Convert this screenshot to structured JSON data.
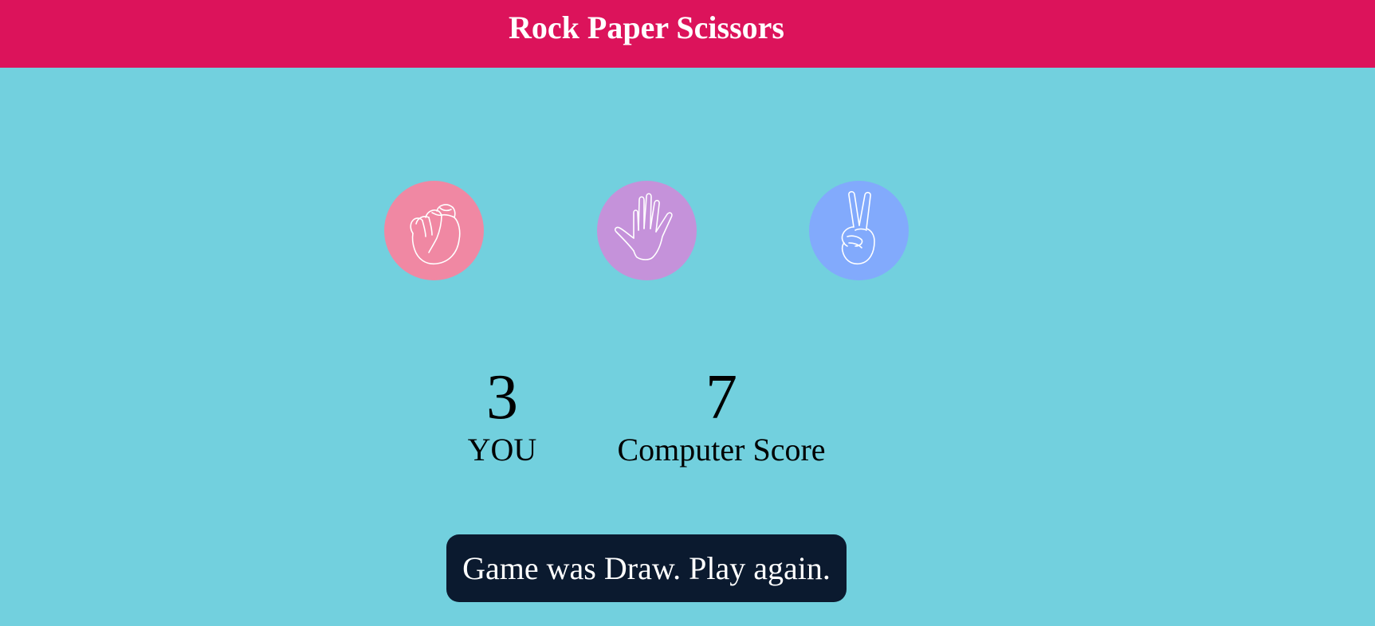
{
  "header": {
    "title": "Rock Paper Scissors"
  },
  "choices": [
    {
      "id": "rock",
      "icon": "rock-fist-icon",
      "color": "#f088a3"
    },
    {
      "id": "paper",
      "icon": "paper-hand-icon",
      "color": "#c592da"
    },
    {
      "id": "scissors",
      "icon": "scissors-peace-icon",
      "color": "#82aafc"
    }
  ],
  "scores": {
    "you": {
      "value": "3",
      "label": "YOU"
    },
    "computer": {
      "value": "7",
      "label": "Computer Score"
    }
  },
  "message": "Game was Draw. Play again.",
  "colors": {
    "header_bg": "#dc135b",
    "page_bg": "#72d0de",
    "message_bg": "#0b1a2f"
  }
}
